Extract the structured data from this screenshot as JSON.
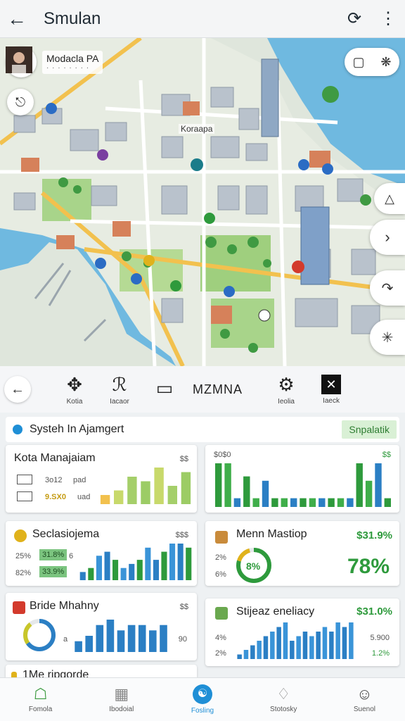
{
  "header": {
    "title": "Smulan",
    "back_icon": "arrow-left-icon",
    "actions": [
      "refresh-icon",
      "more-vert-icon"
    ]
  },
  "map": {
    "profile_name": "Modacla PA",
    "profile_sub": "· · · · · · · ·",
    "district_label": "Koraapa"
  },
  "toolbar": {
    "items": [
      {
        "label": "Kotia",
        "icon": "satellite-icon"
      },
      {
        "label": "Iacaor",
        "icon": "tool-icon"
      },
      {
        "label": "",
        "icon": "screen-icon"
      }
    ],
    "middle_title": "MZMNA",
    "right_items": [
      {
        "label": "Ieolia",
        "icon": "settings-icon"
      },
      {
        "label": "Iaeck",
        "icon": "close-box-icon"
      }
    ]
  },
  "dashboard": {
    "system_title": "Systeh In Ajamgert",
    "system_badge": "Snpalatik",
    "cards": {
      "kota": {
        "title": "Kota Manajaiam",
        "corner": "$$",
        "row1_val": "3o12",
        "row1_text": "pad",
        "row2_val": "9.SX0",
        "row2_text": "uad"
      },
      "topright": {
        "corner_left": "$0$0",
        "corner_right": "$$"
      },
      "seclas": {
        "title": "Seclasiojema",
        "corner": "$$$",
        "row1_a": "25%",
        "row1_b": "31.8%",
        "row1_c": "6",
        "row2_a": "82%",
        "row2_b": "33.9%"
      },
      "menm": {
        "title": "Menn Mastiop",
        "value": "$31.9%",
        "donut_label": "8%",
        "left1": "2%",
        "left2": "6%",
        "big": "78%"
      },
      "bride": {
        "title": "Bride Mhahny",
        "corner": "$$",
        "left_val": "a",
        "right_val": "90"
      },
      "stijeaz": {
        "title": "Stijeaz eneliacy",
        "value": "$31.0%",
        "left1": "4%",
        "left2": "2%",
        "right1": "5.900",
        "right2": "1.2%"
      },
      "partial": {
        "title": "1Me ripgorde"
      }
    }
  },
  "chart_data": [
    {
      "type": "bar",
      "name": "kota",
      "values": [
        2,
        3,
        6,
        5,
        8,
        4,
        7
      ]
    },
    {
      "type": "bar",
      "name": "topright",
      "values": [
        10,
        10,
        2,
        7,
        2,
        6,
        2,
        2,
        2,
        2,
        2,
        2,
        2,
        2,
        2,
        10,
        6,
        10,
        2
      ]
    },
    {
      "type": "bar",
      "name": "seclas",
      "values": [
        2,
        3,
        6,
        7,
        5,
        3,
        4,
        5,
        8,
        5,
        7,
        9,
        9,
        8
      ]
    },
    {
      "type": "bar",
      "name": "bride",
      "values": [
        2,
        3,
        5,
        6,
        4,
        5,
        5,
        4,
        5
      ]
    },
    {
      "type": "bar",
      "name": "stijeaz",
      "values": [
        1,
        2,
        3,
        4,
        5,
        6,
        7,
        8,
        4,
        5,
        6,
        5,
        6,
        7,
        6,
        8,
        7,
        8
      ]
    }
  ],
  "bottom_nav": [
    {
      "label": "Fomola",
      "icon": "home-icon",
      "active": false
    },
    {
      "label": "Ibodoial",
      "icon": "calendar-icon",
      "active": false
    },
    {
      "label": "Fosling",
      "icon": "globe-icon",
      "active": true
    },
    {
      "label": "Stotosky",
      "icon": "bell-icon",
      "active": false
    },
    {
      "label": "Suenol",
      "icon": "person-icon",
      "active": false
    }
  ]
}
